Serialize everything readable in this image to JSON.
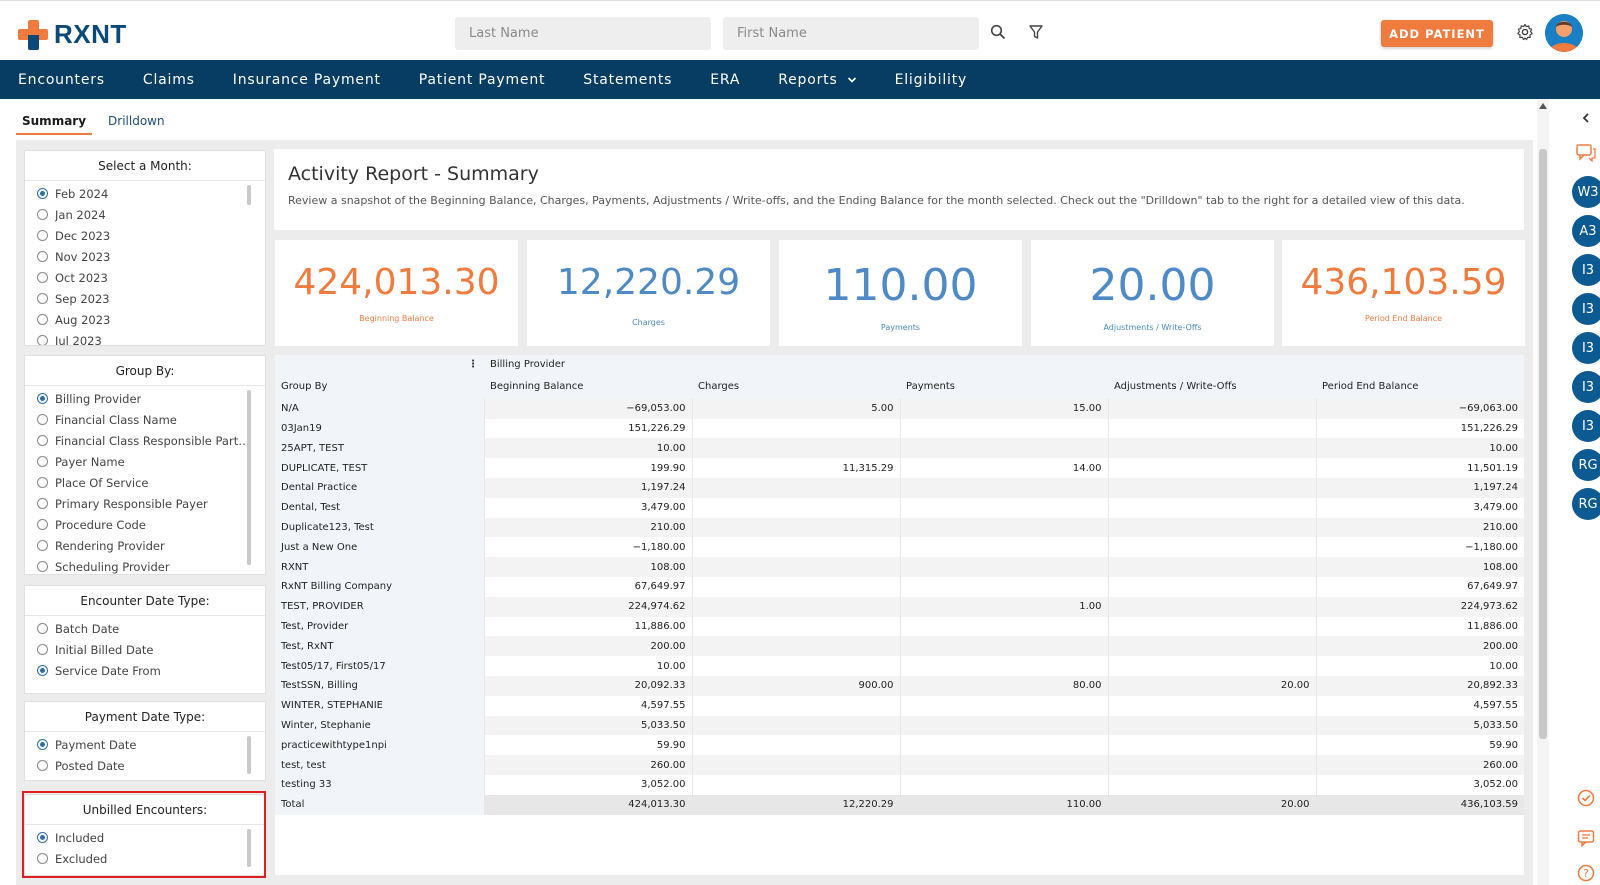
{
  "header": {
    "logo_text": "RXNT",
    "last_name_placeholder": "Last Name",
    "first_name_placeholder": "First Name",
    "add_patient_label": "ADD PATIENT"
  },
  "nav": {
    "items": [
      "Encounters",
      "Claims",
      "Insurance Payment",
      "Patient Payment",
      "Statements",
      "ERA",
      "Reports",
      "Eligibility"
    ]
  },
  "subtabs": {
    "summary": "Summary",
    "drilldown": "Drilldown"
  },
  "filters": {
    "month": {
      "title": "Select a Month:",
      "options": [
        "Feb 2024",
        "Jan 2024",
        "Dec 2023",
        "Nov 2023",
        "Oct 2023",
        "Sep 2023",
        "Aug 2023",
        "Jul 2023"
      ],
      "selected": "Feb 2024"
    },
    "group_by": {
      "title": "Group By:",
      "options": [
        "Billing Provider",
        "Financial Class Name",
        "Financial Class Responsible Party N...",
        "Payer Name",
        "Place Of Service",
        "Primary Responsible Payer",
        "Procedure Code",
        "Rendering Provider",
        "Scheduling Provider"
      ],
      "selected": "Billing Provider"
    },
    "encounter_date_type": {
      "title": "Encounter Date Type:",
      "options": [
        "Batch Date",
        "Initial Billed Date",
        "Service Date From"
      ],
      "selected": "Service Date From"
    },
    "payment_date_type": {
      "title": "Payment Date Type:",
      "options": [
        "Payment Date",
        "Posted Date"
      ],
      "selected": "Payment Date"
    },
    "unbilled": {
      "title": "Unbilled Encounters:",
      "options": [
        "Included",
        "Excluded"
      ],
      "selected": "Included"
    }
  },
  "summary": {
    "title": "Activity Report - Summary",
    "description": "Review a snapshot of the Beginning Balance, Charges, Payments, Adjustments / Write-offs, and the Ending Balance for the month selected. Check out the \"Drilldown\" tab to the right for a detailed view of this data."
  },
  "kpis": [
    {
      "value": "424,013.30",
      "label": "Beginning Balance",
      "color": "#f07b3f"
    },
    {
      "value": "12,220.29",
      "label": "Charges",
      "color": "#4d8ac6"
    },
    {
      "value": "110.00",
      "label": "Payments",
      "color": "#4d8ac6"
    },
    {
      "value": "20.00",
      "label": "Adjustments / Write-Offs",
      "color": "#4d8ac6"
    },
    {
      "value": "436,103.59",
      "label": "Period End Balance",
      "color": "#f07b3f"
    }
  ],
  "table": {
    "pivot_label": "Billing Provider",
    "group_by_header": "Group By",
    "columns": [
      "Beginning Balance",
      "Charges",
      "Payments",
      "Adjustments / Write-Offs",
      "Period End Balance"
    ],
    "rows": [
      {
        "name": "N/A",
        "values": [
          "−69,053.00",
          "5.00",
          "15.00",
          "",
          "−69,063.00"
        ]
      },
      {
        "name": "03Jan19",
        "values": [
          "151,226.29",
          "",
          "",
          "",
          "151,226.29"
        ]
      },
      {
        "name": "25APT, TEST",
        "values": [
          "10.00",
          "",
          "",
          "",
          "10.00"
        ]
      },
      {
        "name": "DUPLICATE, TEST",
        "values": [
          "199.90",
          "11,315.29",
          "14.00",
          "",
          "11,501.19"
        ]
      },
      {
        "name": "Dental Practice",
        "values": [
          "1,197.24",
          "",
          "",
          "",
          "1,197.24"
        ]
      },
      {
        "name": "Dental, Test",
        "values": [
          "3,479.00",
          "",
          "",
          "",
          "3,479.00"
        ]
      },
      {
        "name": "Duplicate123, Test",
        "values": [
          "210.00",
          "",
          "",
          "",
          "210.00"
        ]
      },
      {
        "name": "Just a New One",
        "values": [
          "−1,180.00",
          "",
          "",
          "",
          "−1,180.00"
        ]
      },
      {
        "name": "RXNT",
        "values": [
          "108.00",
          "",
          "",
          "",
          "108.00"
        ]
      },
      {
        "name": "RxNT Billing Company",
        "values": [
          "67,649.97",
          "",
          "",
          "",
          "67,649.97"
        ]
      },
      {
        "name": "TEST, PROVIDER",
        "values": [
          "224,974.62",
          "",
          "1.00",
          "",
          "224,973.62"
        ]
      },
      {
        "name": "Test, Provider",
        "values": [
          "11,886.00",
          "",
          "",
          "",
          "11,886.00"
        ]
      },
      {
        "name": "Test, RxNT",
        "values": [
          "200.00",
          "",
          "",
          "",
          "200.00"
        ]
      },
      {
        "name": "Test05/17, First05/17",
        "values": [
          "10.00",
          "",
          "",
          "",
          "10.00"
        ]
      },
      {
        "name": "TestSSN, Billing",
        "values": [
          "20,092.33",
          "900.00",
          "80.00",
          "20.00",
          "20,892.33"
        ]
      },
      {
        "name": "WINTER, STEPHANIE",
        "values": [
          "4,597.55",
          "",
          "",
          "",
          "4,597.55"
        ]
      },
      {
        "name": "Winter, Stephanie",
        "values": [
          "5,033.50",
          "",
          "",
          "",
          "5,033.50"
        ]
      },
      {
        "name": "practicewithtype1npi",
        "values": [
          "59.90",
          "",
          "",
          "",
          "59.90"
        ]
      },
      {
        "name": "test, test",
        "values": [
          "260.00",
          "",
          "",
          "",
          "260.00"
        ]
      },
      {
        "name": "testing 33",
        "values": [
          "3,052.00",
          "",
          "",
          "",
          "3,052.00"
        ]
      }
    ],
    "total": {
      "name": "Total",
      "values": [
        "424,013.30",
        "12,220.29",
        "110.00",
        "20.00",
        "436,103.59"
      ]
    }
  },
  "rail": {
    "chips": [
      "W3",
      "A3",
      "I3",
      "I3",
      "I3",
      "I3",
      "I3",
      "RG",
      "RG"
    ]
  },
  "colors": {
    "brand_orange": "#f07b3f",
    "nav_blue": "#073d63",
    "accent_blue": "#4d8ac6"
  }
}
